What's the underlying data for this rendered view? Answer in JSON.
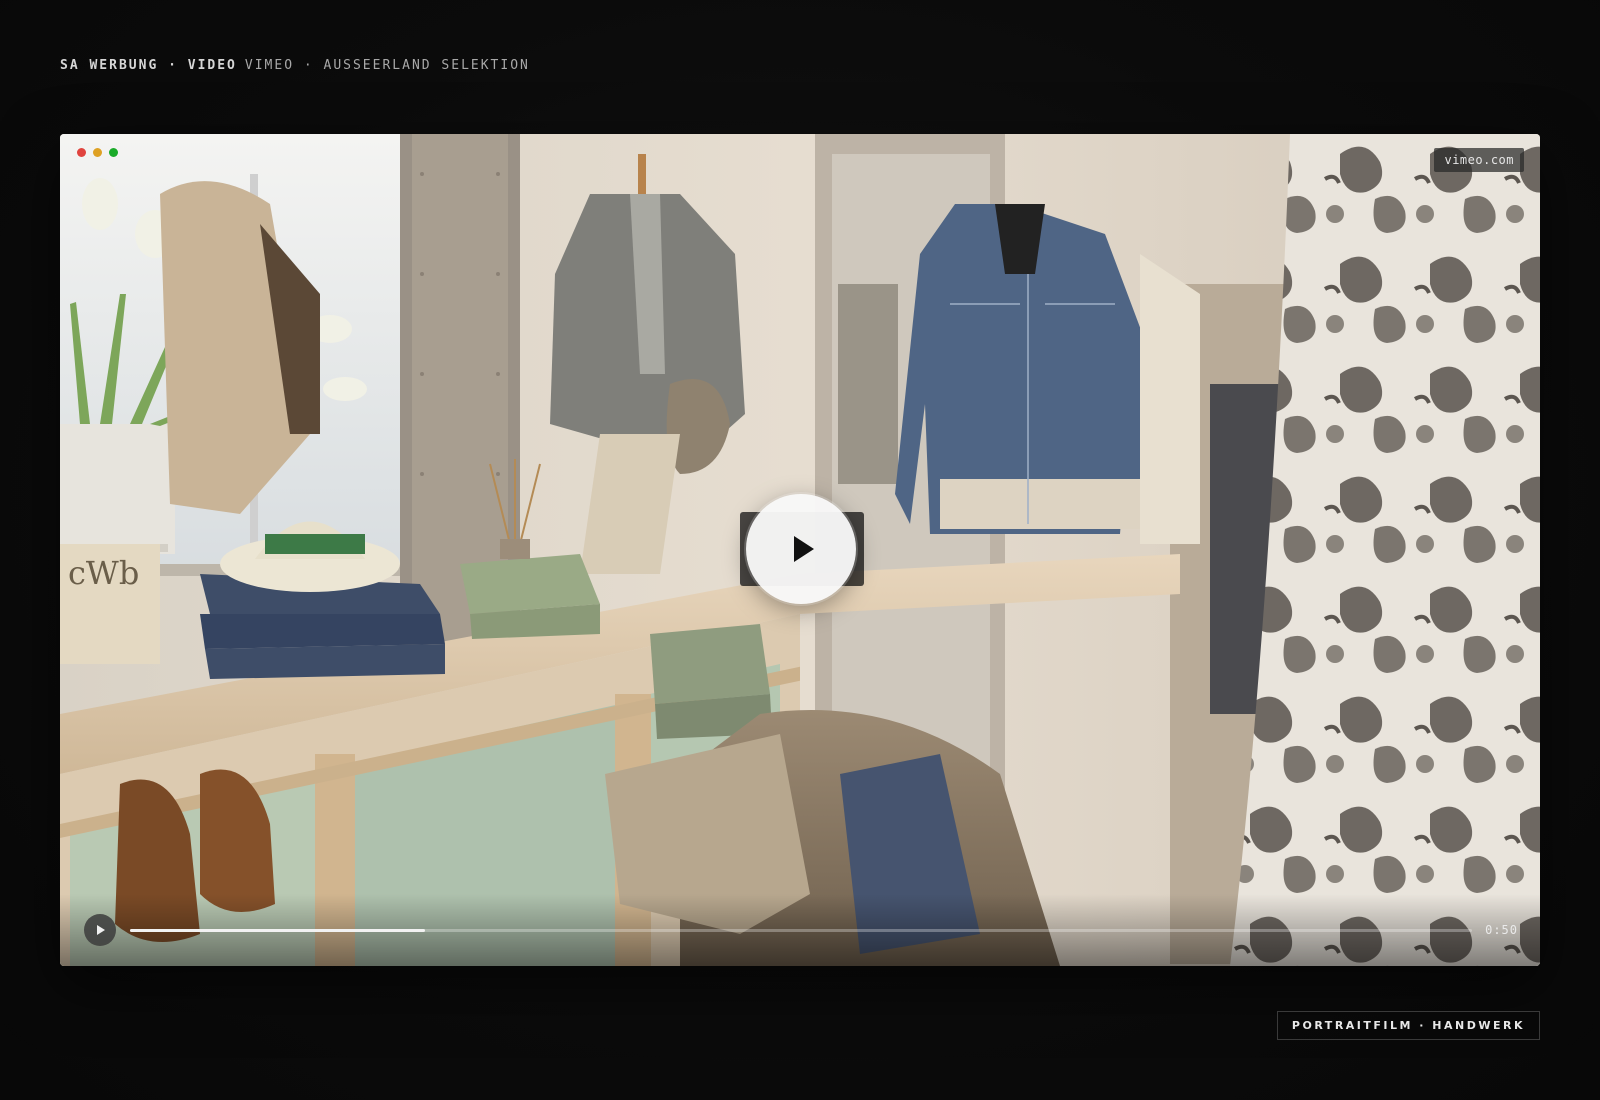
{
  "header": {
    "brand": "SA WERBUNG · VIDEO",
    "subtitle": "VIMEO · AUSSEERLAND SELEKTION"
  },
  "player": {
    "badge": "vimeo.com",
    "time": "0:50",
    "progress": 0.22,
    "window_dots": [
      "#e0443e",
      "#dea123",
      "#1aab29"
    ],
    "big_play_icon": "play-icon",
    "small_play_icon": "play-icon"
  },
  "footer": {
    "tag": "PORTRAITFILM · HANDWERK"
  },
  "colors": {
    "background": "#0b0b0b",
    "progress_fill": "#f2f2f2"
  }
}
